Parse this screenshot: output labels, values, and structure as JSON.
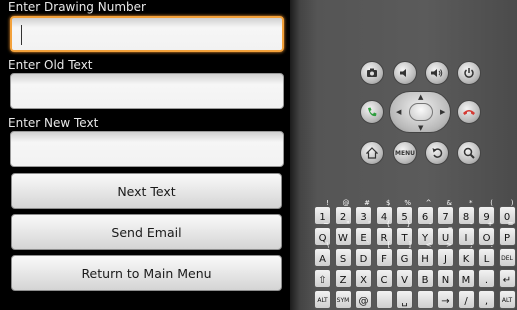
{
  "form": {
    "drawing_label": "Enter Drawing Number",
    "drawing_value": "",
    "old_label": "Enter Old Text",
    "old_value": "",
    "new_label": "Enter New Text",
    "new_value": ""
  },
  "buttons": {
    "next": "Next Text",
    "email": "Send Email",
    "main_menu": "Return to Main Menu"
  },
  "emulator": {
    "menu_label": "MENU",
    "keyboard": {
      "row1": [
        [
          "1",
          "!"
        ],
        [
          "2",
          "@"
        ],
        [
          "3",
          "#"
        ],
        [
          "4",
          "$"
        ],
        [
          "5",
          "%"
        ],
        [
          "6",
          "^"
        ],
        [
          "7",
          "&"
        ],
        [
          "8",
          "*"
        ],
        [
          "9",
          "("
        ],
        [
          "0",
          ")"
        ]
      ],
      "row2": [
        [
          "Q",
          "~"
        ],
        [
          "W",
          "\""
        ],
        [
          "E",
          "'"
        ],
        [
          "R",
          "{"
        ],
        [
          "T",
          "}"
        ],
        [
          "Y",
          "-"
        ],
        [
          "U",
          "_"
        ],
        [
          "I",
          "-"
        ],
        [
          "O",
          "+"
        ],
        [
          "P",
          "="
        ]
      ],
      "row3": [
        [
          "A",
          "\\"
        ],
        [
          "S",
          ""
        ],
        [
          "D",
          "`"
        ],
        [
          "F",
          "["
        ],
        [
          "G",
          "]"
        ],
        [
          "H",
          "<"
        ],
        [
          "J",
          ">"
        ],
        [
          "K",
          ";"
        ],
        [
          "L",
          ":"
        ],
        [
          "DEL",
          ""
        ]
      ],
      "row4": [
        [
          "⇧",
          ""
        ],
        [
          "Z",
          ""
        ],
        [
          "X",
          ""
        ],
        [
          "C",
          ""
        ],
        [
          "V",
          ""
        ],
        [
          "B",
          ""
        ],
        [
          "N",
          ""
        ],
        [
          "M",
          ""
        ],
        [
          ".",
          ""
        ],
        [
          "↵",
          ""
        ]
      ],
      "row5": [
        [
          "ALT",
          ""
        ],
        [
          "SYM",
          ""
        ],
        [
          "@",
          ""
        ],
        [
          "",
          ""
        ],
        [
          "␣",
          ""
        ],
        [
          "",
          ""
        ],
        [
          "→",
          ""
        ],
        [
          "/",
          ""
        ],
        [
          ",",
          ""
        ],
        [
          "ALT",
          ""
        ]
      ]
    }
  },
  "colors": {
    "focus_accent": "#f3a13a",
    "call_green": "#2e9e3e",
    "end_red": "#d43a34"
  }
}
